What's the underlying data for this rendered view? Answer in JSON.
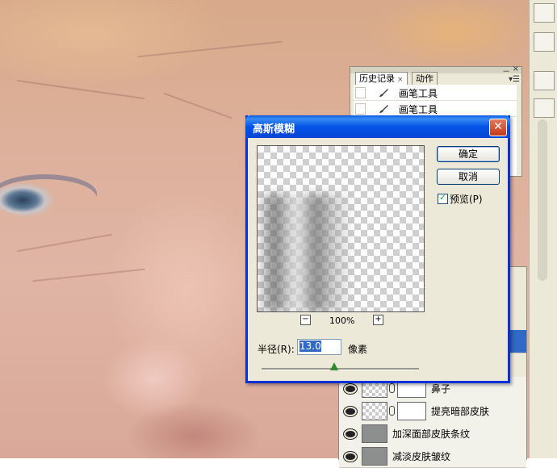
{
  "history_panel": {
    "tabs": [
      {
        "label": "历史记录",
        "close": "×"
      },
      {
        "label": "动作"
      }
    ],
    "menu_glyph": "▾☰",
    "minimize_glyph": "－",
    "close_glyph": "×",
    "items": [
      {
        "label": "画笔工具",
        "icon": "brush-icon"
      },
      {
        "label": "画笔工具",
        "icon": "brush-icon"
      }
    ]
  },
  "dialog": {
    "title": "高斯模糊",
    "close_glyph": "✕",
    "ok_label": "确定",
    "cancel_label": "取消",
    "preview_label": "预览(P)",
    "preview_checked": true,
    "zoom_out_glyph": "−",
    "zoom_in_glyph": "+",
    "zoom_value": "100%",
    "radius_label": "半径(R):",
    "radius_value": "13.0",
    "radius_unit": "像素",
    "slider_level_fraction": 0.46
  },
  "layers_panel": {
    "layers": [
      {
        "name": "鼻子",
        "has_mask": true,
        "thumb": "transparent"
      },
      {
        "name": "提亮暗部皮肤",
        "has_mask": true,
        "thumb": "transparent"
      },
      {
        "name": "加深面部皮肤条纹",
        "has_mask": false,
        "thumb": "gray"
      },
      {
        "name": "减淡皮肤皱纹",
        "has_mask": false,
        "thumb": "gray"
      }
    ]
  }
}
